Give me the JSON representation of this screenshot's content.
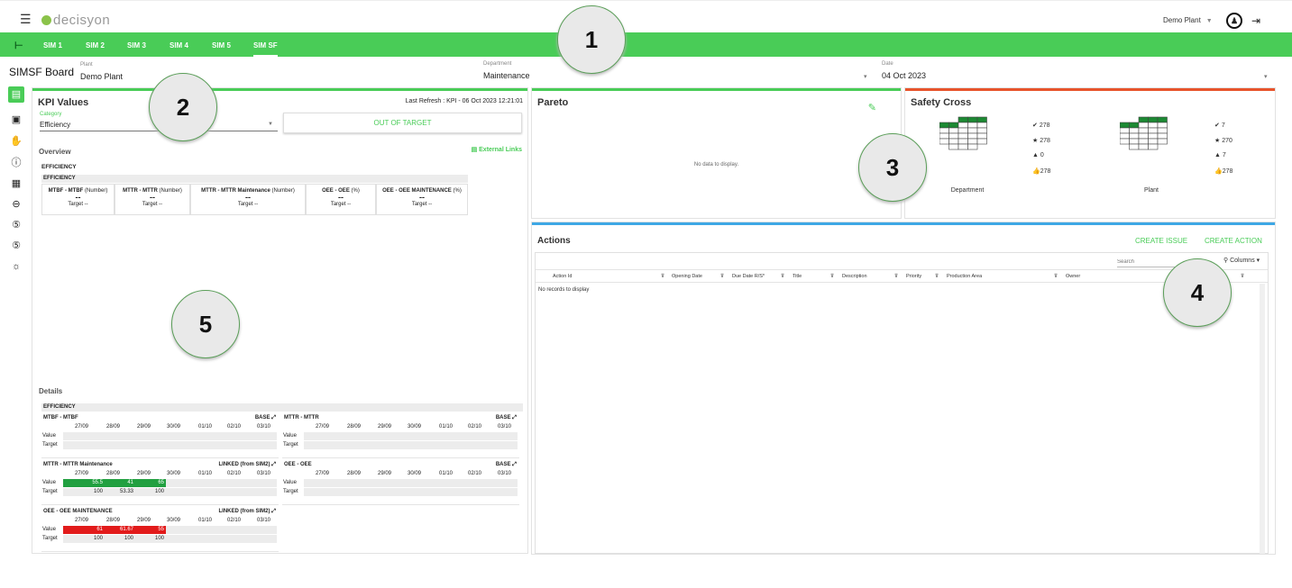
{
  "topbar": {
    "app_name": "decisyon",
    "plant": "Demo Plant",
    "user_icon": "user-icon",
    "logout_icon": "logout-icon"
  },
  "tabs": [
    {
      "label": "SIM 1"
    },
    {
      "label": "SIM 2"
    },
    {
      "label": "SIM 3"
    },
    {
      "label": "SIM 4"
    },
    {
      "label": "SIM 5"
    },
    {
      "label": "SIM SF"
    }
  ],
  "filters": {
    "board_title": "SIMSF Board",
    "plant_label": "Plant",
    "plant_value": "Demo Plant",
    "department_label": "Department",
    "department_value": "Maintenance",
    "date_label": "Date",
    "date_value": "04 Oct 2023"
  },
  "sidebar": [
    "dashboard-icon",
    "clipboard-icon",
    "hand-icon",
    "info-icon",
    "report-icon",
    "link-icon",
    "s-icon",
    "s-outline-icon",
    "idea-icon"
  ],
  "kpi": {
    "title": "KPI Values",
    "last_refresh": "Last Refresh : KPI - 06 Oct 2023 12:21:01",
    "category_label": "Category",
    "category_value": "Efficiency",
    "status_button": "OUT OF TARGET",
    "overview_label": "Overview",
    "external_links": "External Links",
    "group_title": "EFFICIENCY",
    "group_header": "EFFICIENCY",
    "boxes": [
      {
        "name": "MTBF - MTBF",
        "unit": "(Number)",
        "value": "--",
        "target": "Target --"
      },
      {
        "name": "MTTR - MTTR",
        "unit": "(Number)",
        "value": "--",
        "target": "Target --"
      },
      {
        "name": "MTTR - MTTR Maintenance",
        "unit": "(Number)",
        "value": "--",
        "target": "Target --"
      },
      {
        "name": "OEE - OEE",
        "unit": "(%)",
        "value": "--",
        "target": "Target --"
      },
      {
        "name": "OEE - OEE MAINTENANCE",
        "unit": "(%)",
        "value": "--",
        "target": "Target --"
      }
    ],
    "details_label": "Details",
    "details_header": "EFFICIENCY",
    "dates": [
      "27/09",
      "28/09",
      "29/09",
      "30/09",
      "01/10",
      "02/10",
      "03/10"
    ],
    "value_label": "Value",
    "target_label": "Target",
    "details": [
      {
        "name": "MTBF - MTBF",
        "type": "BASE",
        "values": [],
        "targets": []
      },
      {
        "name": "MTTR - MTTR",
        "type": "BASE",
        "values": [],
        "targets": []
      },
      {
        "name": "MTTR - MTTR Maintenance",
        "type": "LINKED (from SIM2)",
        "values": [
          "55.5",
          "41",
          "65"
        ],
        "targets": [
          "100",
          "53.33",
          "100"
        ],
        "status": "green"
      },
      {
        "name": "OEE - OEE",
        "type": "BASE",
        "values": [],
        "targets": []
      },
      {
        "name": "OEE - OEE MAINTENANCE",
        "type": "LINKED (from SIM2)",
        "values": [
          "61",
          "61.67",
          "55"
        ],
        "targets": [
          "100",
          "100",
          "100"
        ],
        "status": "red"
      }
    ]
  },
  "pareto": {
    "title": "Pareto",
    "no_data": "No data to display."
  },
  "safety": {
    "title": "Safety Cross",
    "department": {
      "label": "Department",
      "stats": [
        "278",
        "278",
        "0",
        "278"
      ]
    },
    "plant": {
      "label": "Plant",
      "stats": [
        "7",
        "270",
        "7",
        "278"
      ]
    }
  },
  "actions": {
    "title": "Actions",
    "create_issue": "CREATE ISSUE",
    "create_action": "CREATE ACTION",
    "search_placeholder": "Search",
    "columns_label": "Columns",
    "headers": [
      "Action Id",
      "Opening Date",
      "Due Date R/S*",
      "Title",
      "Description",
      "Priority",
      "Production Area",
      "Owner"
    ],
    "empty": "No records to display"
  },
  "callouts": [
    "1",
    "2",
    "3",
    "4",
    "5"
  ],
  "colors": {
    "brand_green": "#49cc57",
    "good": "#21a040",
    "bad": "#e21b1b",
    "safety_accent": "#e8542c",
    "actions_accent": "#3ea8e5"
  }
}
